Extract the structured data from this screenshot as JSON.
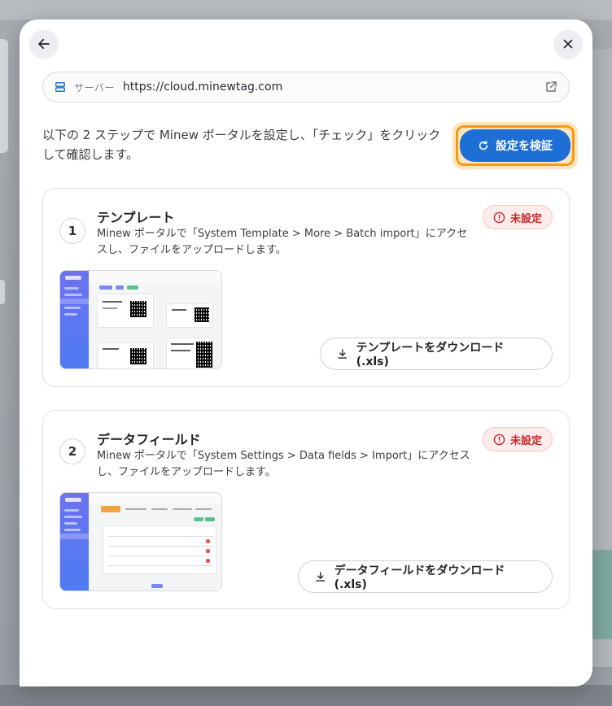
{
  "server": {
    "label": "サーバー",
    "url": "https://cloud.minewtag.com"
  },
  "intro": {
    "text": "以下の 2 ステップで Minew ポータルを設定し、「チェック」をクリックして確認します。"
  },
  "verify_button": {
    "label": "設定を検証"
  },
  "steps": [
    {
      "number": "1",
      "title": "テンプレート",
      "description": "Minew ポータルで「System Template > More > Batch import」にアクセスし、ファイルをアップロードします。",
      "status": "未設定",
      "download_label": "テンプレートをダウンロード (.xls)"
    },
    {
      "number": "2",
      "title": "データフィールド",
      "description": "Minew ポータルで「System Settings > Data fields > Import」にアクセスし、ファイルをアップロードします。",
      "status": "未設定",
      "download_label": "データフィールドをダウンロード (.xls)"
    }
  ],
  "icons": {
    "back": "arrow-left-icon",
    "close": "close-icon",
    "server": "server-icon",
    "external": "external-link-icon",
    "refresh": "refresh-icon",
    "alert": "alert-circle-icon",
    "download": "download-icon"
  },
  "colors": {
    "primary": "#1d6fd6",
    "highlight": "#f39b12",
    "status_error": "#c62828",
    "status_error_bg": "#fdecec"
  }
}
